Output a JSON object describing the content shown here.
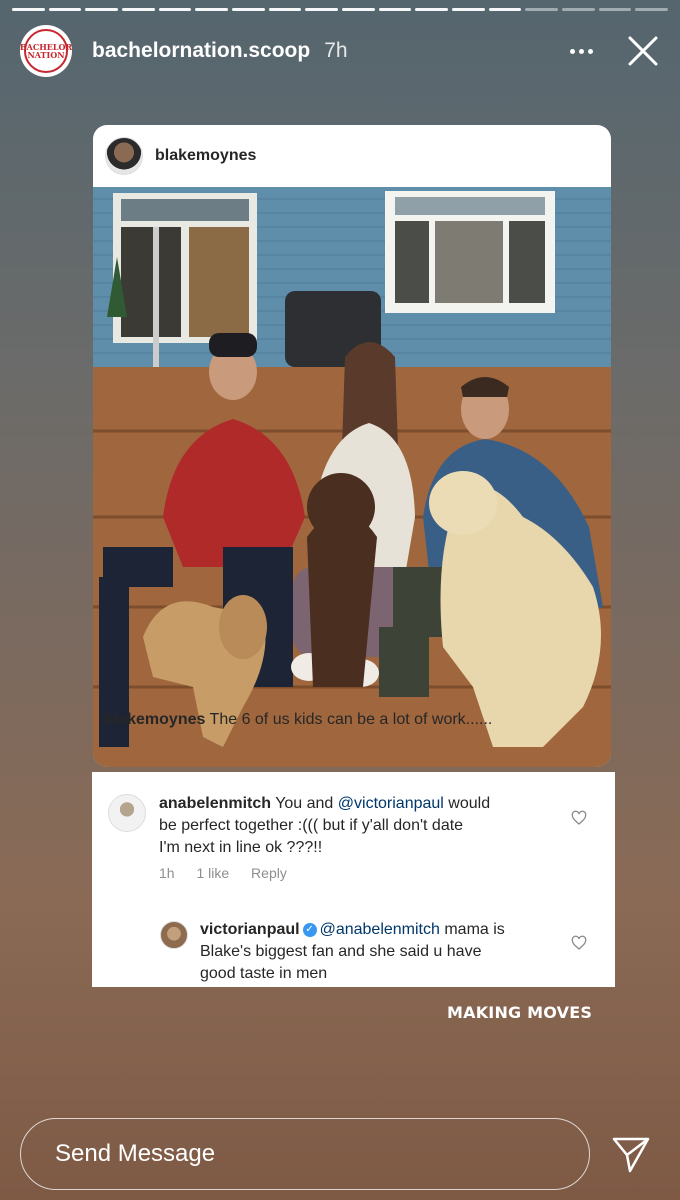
{
  "story": {
    "segments_total": 18,
    "segments_viewed": 14
  },
  "header": {
    "avatar_text": "BACHELOR NATION",
    "username": "bachelornation.scoop",
    "time_ago": "7h",
    "more_icon": "more-horizontal-icon",
    "close_icon": "close-icon"
  },
  "post": {
    "username": "blakemoynes",
    "caption_user": "blakemoynes",
    "caption_text": " The 6 of us kids can be a lot of work......"
  },
  "comments": [
    {
      "username": "anabelenmitch",
      "text_before": " You and ",
      "mention": "@victorianpaul",
      "text_line1_after": " would",
      "text_line2": "be perfect together :((( but if y'all don't date",
      "text_line3": "I'm next in line ok ???!!",
      "time": "1h",
      "likes": "1 like",
      "reply": "Reply"
    },
    {
      "username": "victorianpaul",
      "verified": true,
      "mention": "@anabelenmitch",
      "text_line1_after": " mama is",
      "text_line2": "Blake's biggest fan and she said u have",
      "text_line3": "good taste in men"
    }
  ],
  "sticker_text": "MAKING MOVES",
  "footer": {
    "send_placeholder": "Send Message",
    "send_icon": "paper-plane-icon"
  },
  "colors": {
    "brand_red": "#c7272f",
    "link_blue": "#00376b",
    "verified_blue": "#3897f0"
  }
}
